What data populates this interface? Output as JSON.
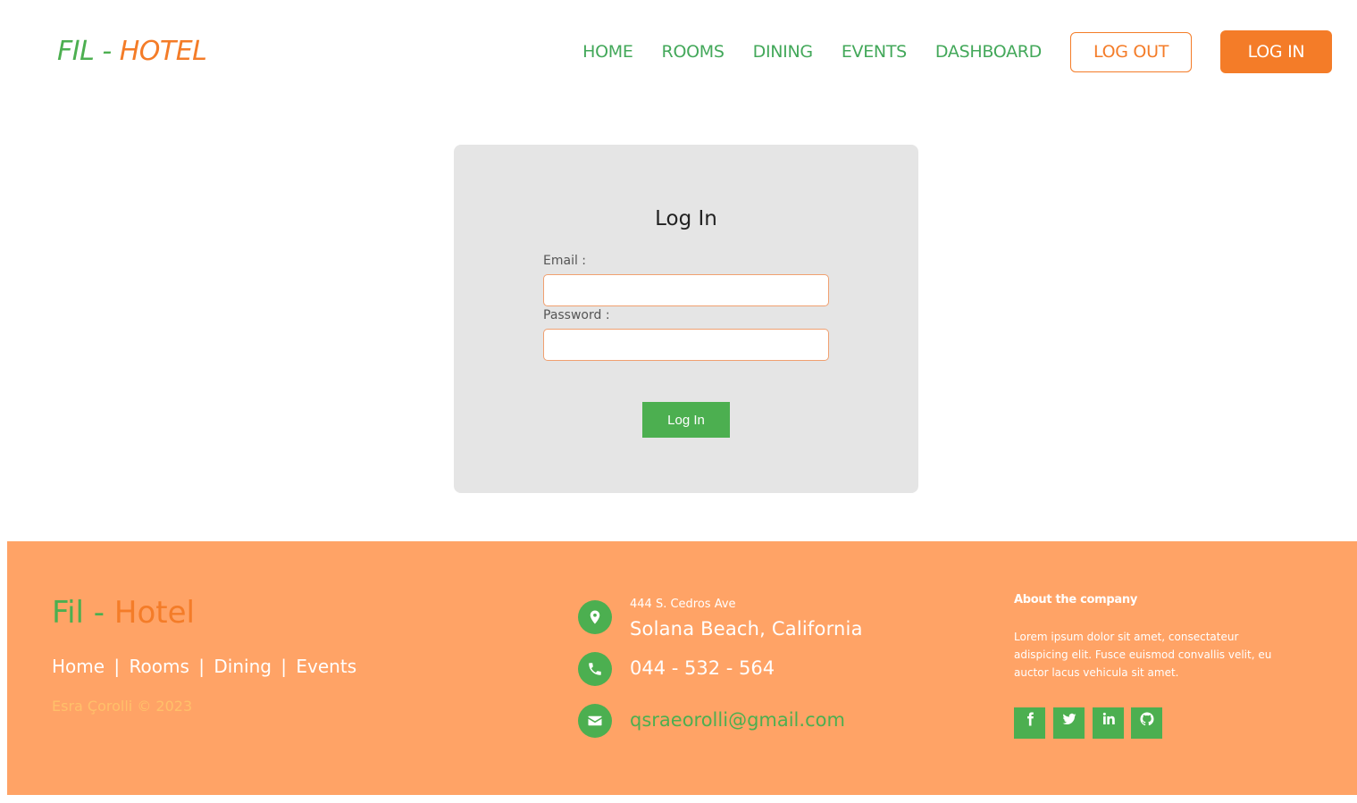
{
  "header": {
    "logo_part1": "FIL -",
    "logo_part2": "HOTEL",
    "nav": [
      "HOME",
      "ROOMS",
      "DINING",
      "EVENTS",
      "DASHBOARD"
    ],
    "logout_label": "LOG OUT",
    "login_label": "LOG IN"
  },
  "login_form": {
    "title": "Log In",
    "email_label": "Email :",
    "email_value": "",
    "password_label": "Password :",
    "password_value": "",
    "submit_label": "Log In"
  },
  "footer": {
    "brand_part1": "Fil -",
    "brand_part2": "Hotel",
    "links": [
      "Home",
      "Rooms",
      "Dining",
      "Events"
    ],
    "link_separator": "|",
    "copyright": "Esra Çorolli © 2023",
    "address_street": "444 S. Cedros Ave",
    "address_city": "Solana Beach, California",
    "phone": "044 - 532 - 564",
    "email": "qsraeorolli@gmail.com",
    "about_title": "About the company",
    "about_text": "Lorem ipsum dolor sit amet, consectateur adispicing elit. Fusce euismod convallis velit, eu auctor lacus vehicula sit amet.",
    "social_icons": [
      "facebook-icon",
      "twitter-icon",
      "linkedin-icon",
      "github-icon"
    ]
  },
  "colors": {
    "green": "#4caf50",
    "orange": "#f47c28",
    "footer_bg": "#ffa366",
    "card_bg": "#e5e5e5"
  }
}
